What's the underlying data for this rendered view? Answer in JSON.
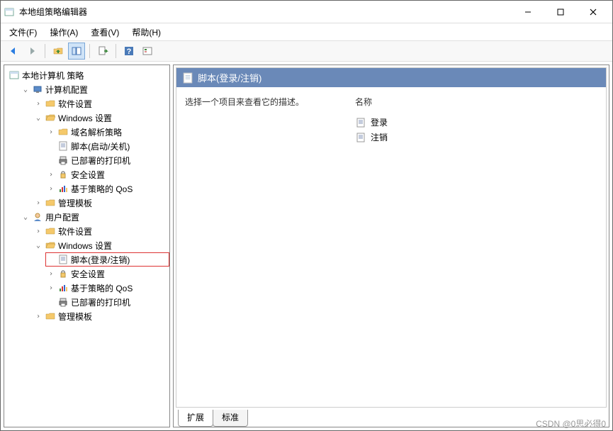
{
  "window": {
    "title": "本地组策略编辑器"
  },
  "menubar": {
    "file": "文件(F)",
    "action": "操作(A)",
    "view": "查看(V)",
    "help": "帮助(H)"
  },
  "tree": {
    "root": "本地计算机 策略",
    "computer_config": "计算机配置",
    "cc_software": "软件设置",
    "cc_windows": "Windows 设置",
    "cc_dns": "域名解析策略",
    "cc_scripts": "脚本(启动/关机)",
    "cc_printers": "已部署的打印机",
    "cc_security": "安全设置",
    "cc_qos": "基于策略的 QoS",
    "cc_admin": "管理模板",
    "user_config": "用户配置",
    "uc_software": "软件设置",
    "uc_windows": "Windows 设置",
    "uc_scripts": "脚本(登录/注销)",
    "uc_security": "安全设置",
    "uc_qos": "基于策略的 QoS",
    "uc_printers": "已部署的打印机",
    "uc_admin": "管理模板"
  },
  "content": {
    "header": "脚本(登录/注销)",
    "description": "选择一个项目来查看它的描述。",
    "column_name": "名称",
    "item_login": "登录",
    "item_logout": "注销"
  },
  "tabs": {
    "extended": "扩展",
    "standard": "标准"
  },
  "watermark": "CSDN @0思必得0"
}
